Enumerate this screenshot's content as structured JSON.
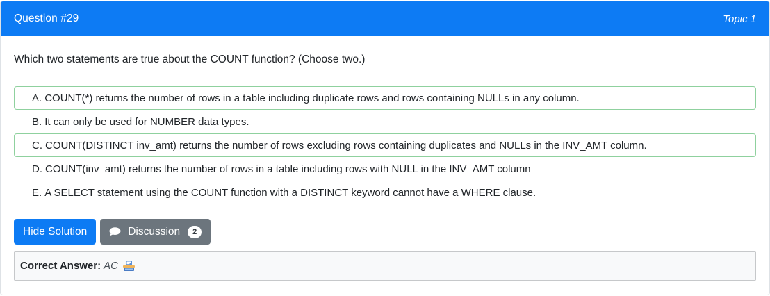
{
  "header": {
    "question_number": "Question #29",
    "topic": "Topic 1"
  },
  "question": {
    "text": "Which two statements are true about the COUNT function? (Choose two.)"
  },
  "choices": [
    {
      "letter": "A.",
      "text": "COUNT(*) returns the number of rows in a table including duplicate rows and rows containing NULLs in any column.",
      "correct": true
    },
    {
      "letter": "B.",
      "text": "It can only be used for NUMBER data types.",
      "correct": false
    },
    {
      "letter": "C.",
      "text": "COUNT(DISTINCT inv_amt) returns the number of rows excluding rows containing duplicates and NULLs in the INV_AMT column.",
      "correct": true
    },
    {
      "letter": "D.",
      "text": "COUNT(inv_amt) returns the number of rows in a table including rows with NULL in the INV_AMT column",
      "correct": false
    },
    {
      "letter": "E.",
      "text": "A SELECT statement using the COUNT function with a DISTINCT keyword cannot have a WHERE clause.",
      "correct": false
    }
  ],
  "buttons": {
    "hide_solution": "Hide Solution",
    "discussion": "Discussion",
    "discussion_count": "2"
  },
  "answer": {
    "label": "Correct Answer:",
    "value": "AC",
    "icon": "vote-distribution-icon"
  },
  "colors": {
    "primary": "#0d7bf4",
    "secondary": "#6c757d",
    "correct_border": "#8fd19e"
  }
}
